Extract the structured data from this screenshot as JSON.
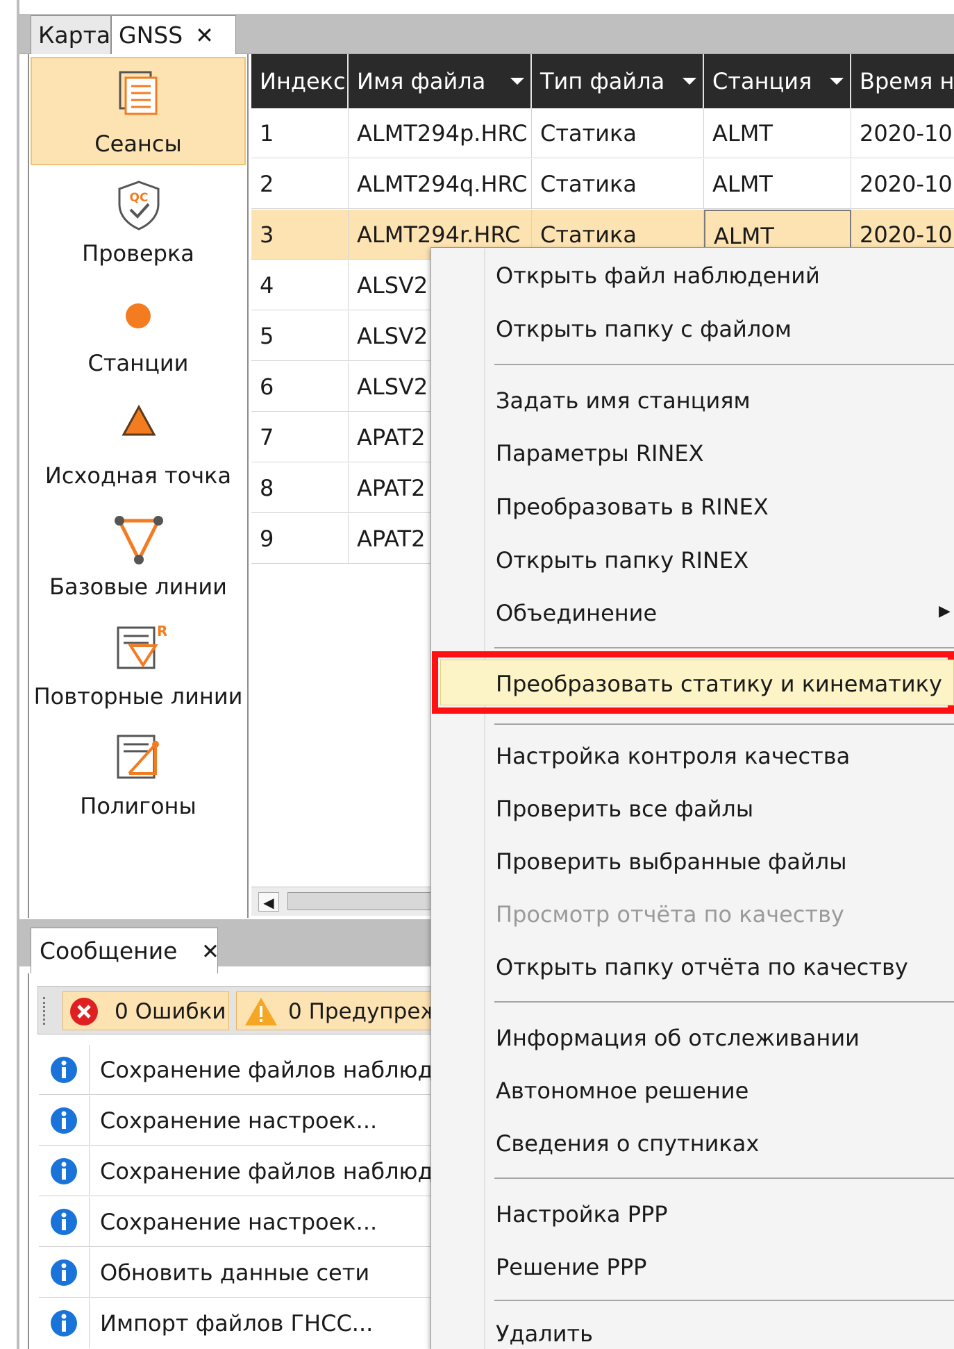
{
  "tabs": [
    {
      "label": "Карта"
    },
    {
      "label": "GNSS",
      "close": "✕"
    }
  ],
  "nav": {
    "items": [
      {
        "label": "Сеансы"
      },
      {
        "label": "Проверка",
        "badge": "QC"
      },
      {
        "label": "Станции"
      },
      {
        "label": "Исходная точка"
      },
      {
        "label": "Базовые линии"
      },
      {
        "label": "Повторные линии",
        "badge": "R"
      },
      {
        "label": "Полигоны"
      }
    ]
  },
  "grid": {
    "columns": [
      "Индекс",
      "Имя файла",
      "Тип файла",
      "Станция",
      "Время н"
    ],
    "rows": [
      [
        "1",
        "ALMT294p.HRC",
        "Статика",
        "ALMT",
        "2020-10"
      ],
      [
        "2",
        "ALMT294q.HRC",
        "Статика",
        "ALMT",
        "2020-10"
      ],
      [
        "3",
        "ALMT294r.HRC",
        "Статика",
        "ALMT",
        "2020-10"
      ],
      [
        "4",
        "ALSV2",
        "",
        "",
        ""
      ],
      [
        "5",
        "ALSV2",
        "",
        "",
        ""
      ],
      [
        "6",
        "ALSV2",
        "",
        "",
        ""
      ],
      [
        "7",
        "APAT2",
        "",
        "",
        ""
      ],
      [
        "8",
        "APAT2",
        "",
        "",
        ""
      ],
      [
        "9",
        "APAT2",
        "",
        "",
        ""
      ]
    ]
  },
  "messages": {
    "tab_label": "Сообщение",
    "tab_close": "✕",
    "errors_label": "0 Ошибки",
    "warnings_label": "0 Предупреж",
    "items": [
      "Сохранение файлов наблюде",
      "Сохранение настроек...",
      "Сохранение файлов наблюде",
      "Сохранение настроек...",
      "Обновить данные сети",
      "Импорт файлов ГНСС..."
    ]
  },
  "context_menu": {
    "items": [
      "Открыть файл наблюдений",
      "Открыть папку с файлом",
      "Задать имя станциям",
      "Параметры RINEX",
      "Преобразовать в RINEX",
      "Открыть папку RINEX",
      "Объединение",
      "Преобразовать статику и кинематику",
      "Настройка контроля качества",
      "Проверить все файлы",
      "Проверить выбранные файлы",
      "Просмотр отчёта по качеству",
      "Открыть папку отчёта по качеству",
      "Информация об отслеживании",
      "Автономное решение",
      "Сведения о спутниках",
      "Настройка PPP",
      "Решение PPP",
      "Удалить"
    ],
    "submenu_arrow": "▶",
    "disabled_item_index": 11,
    "highlighted_item_index": 7
  },
  "colors": {
    "accent_orange": "#f47c20",
    "selection": "#fde3b2",
    "highlight_red": "#ff1111",
    "info_blue": "#1a73d9"
  }
}
